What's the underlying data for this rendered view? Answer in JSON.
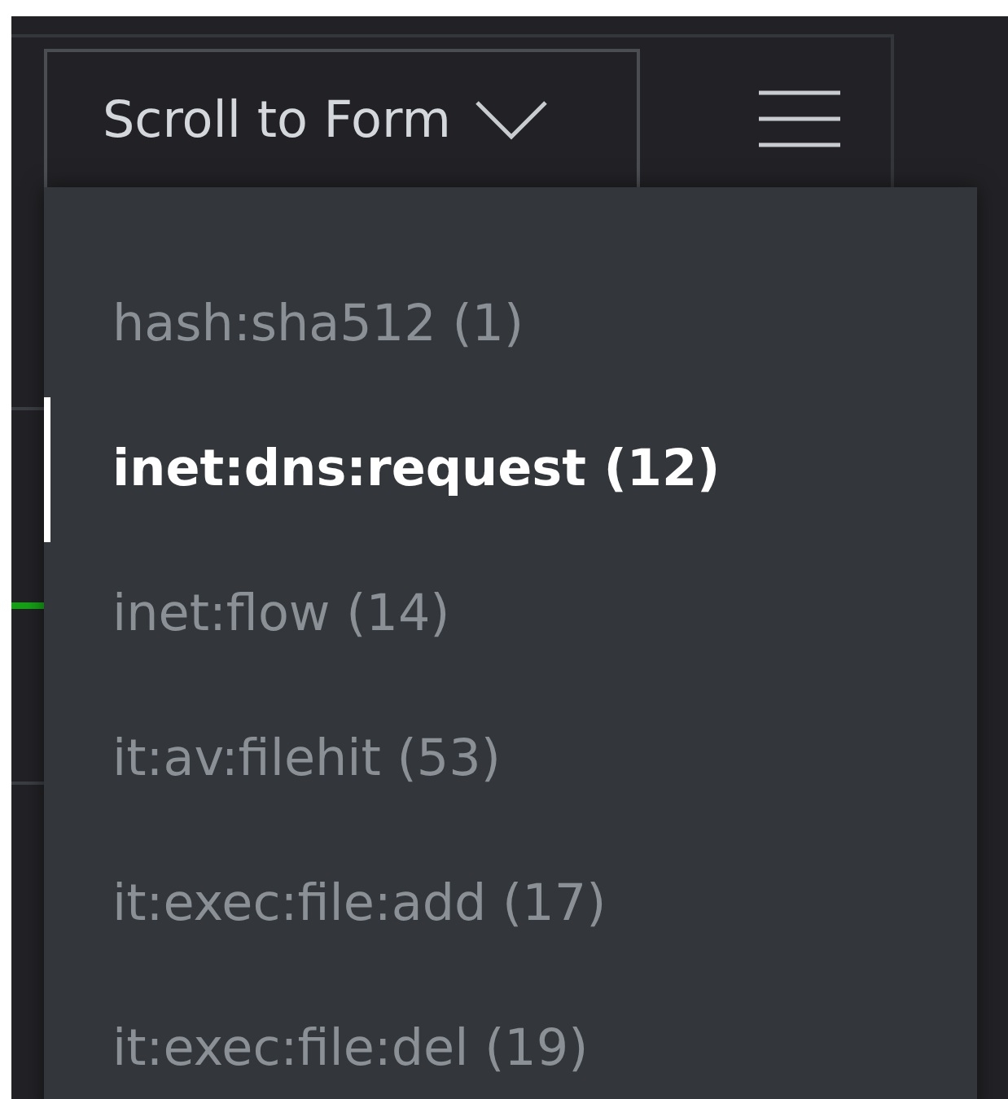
{
  "scroll_button": {
    "label": "Scroll to Form"
  },
  "menu_items": [
    {
      "label": "hash:sha512 (1)",
      "selected": false
    },
    {
      "label": "inet:dns:request (12)",
      "selected": true
    },
    {
      "label": "inet:flow (14)",
      "selected": false
    },
    {
      "label": "it:av:filehit (53)",
      "selected": false
    },
    {
      "label": "it:exec:file:add (17)",
      "selected": false
    },
    {
      "label": "it:exec:file:del (19)",
      "selected": false
    }
  ]
}
